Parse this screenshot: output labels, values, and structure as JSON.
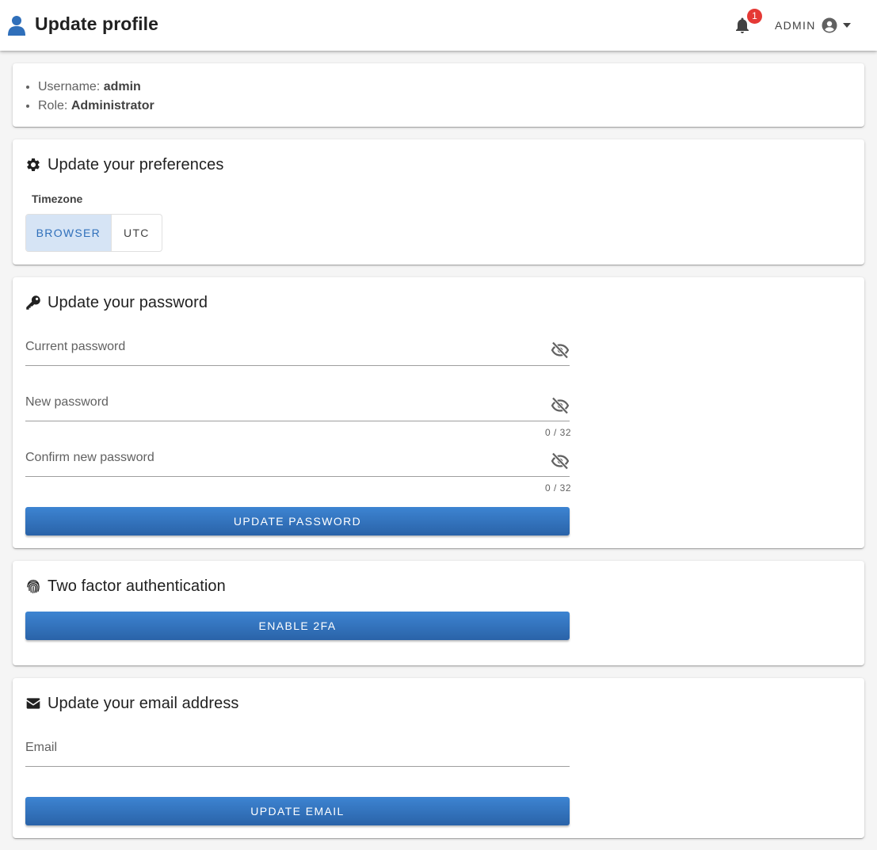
{
  "header": {
    "title": "Update profile",
    "notification_count": "1",
    "user_label": "ADMIN",
    "icons": {
      "page": "user-icon",
      "notifications": "bell-icon",
      "account": "account-circle-icon",
      "menu": "caret-down-icon"
    }
  },
  "account_info": {
    "username_label": "Username:",
    "username_value": "admin",
    "role_label": "Role:",
    "role_value": "Administrator"
  },
  "preferences": {
    "title": "Update your preferences",
    "icon": "gear-icon",
    "timezone_label": "Timezone",
    "timezone_options": [
      "BROWSER",
      "UTC"
    ],
    "timezone_selected": "BROWSER"
  },
  "password": {
    "title": "Update your password",
    "icon": "key-icon",
    "current_label": "Current password",
    "new_label": "New password",
    "new_counter": "0 / 32",
    "confirm_label": "Confirm new password",
    "confirm_counter": "0 / 32",
    "submit_label": "UPDATE PASSWORD"
  },
  "two_factor": {
    "title": "Two factor authentication",
    "icon": "fingerprint-icon",
    "submit_label": "ENABLE 2FA"
  },
  "email": {
    "title": "Update your email address",
    "icon": "envelope-icon",
    "field_label": "Email",
    "submit_label": "UPDATE EMAIL"
  },
  "colors": {
    "accent": "#2f6fba",
    "button_top": "#3d84d2",
    "button_bottom": "#2a63a8",
    "badge": "#e53935",
    "toggle_selected_bg": "#d6e4f5"
  }
}
